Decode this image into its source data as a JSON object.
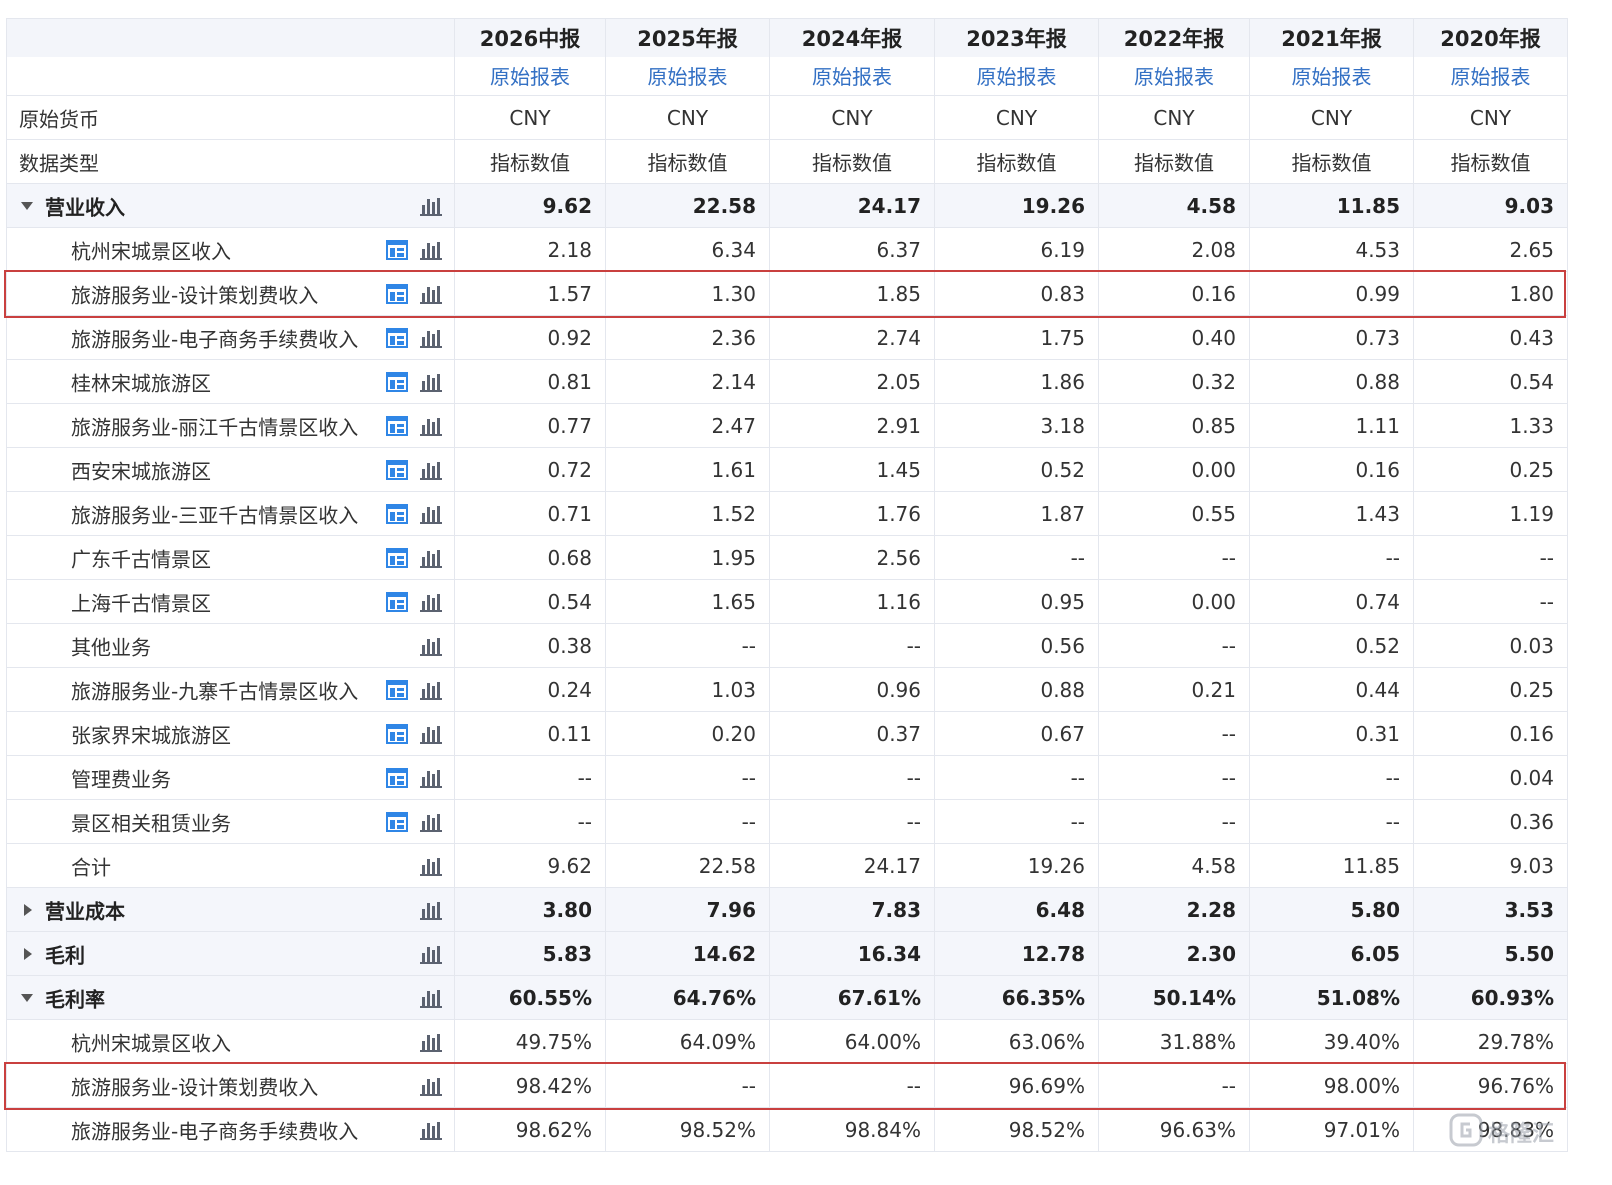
{
  "columns": [
    {
      "year": "2026中报",
      "link": "原始报表"
    },
    {
      "year": "2025年报",
      "link": "原始报表"
    },
    {
      "year": "2024年报",
      "link": "原始报表"
    },
    {
      "year": "2023年报",
      "link": "原始报表"
    },
    {
      "year": "2022年报",
      "link": "原始报表"
    },
    {
      "year": "2021年报",
      "link": "原始报表"
    },
    {
      "year": "2020年报",
      "link": "原始报表"
    }
  ],
  "meta_rows": [
    {
      "label": "原始货币",
      "values": [
        "CNY",
        "CNY",
        "CNY",
        "CNY",
        "CNY",
        "CNY",
        "CNY"
      ]
    },
    {
      "label": "数据类型",
      "values": [
        "指标数值",
        "指标数值",
        "指标数值",
        "指标数值",
        "指标数值",
        "指标数值",
        "指标数值"
      ]
    }
  ],
  "rows": [
    {
      "label": "营业收入",
      "bold": true,
      "caret": "down",
      "level": 0,
      "table_icon": false,
      "values": [
        "9.62",
        "22.58",
        "24.17",
        "19.26",
        "4.58",
        "11.85",
        "9.03"
      ]
    },
    {
      "label": "杭州宋城景区收入",
      "level": 1,
      "table_icon": true,
      "values": [
        "2.18",
        "6.34",
        "6.37",
        "6.19",
        "2.08",
        "4.53",
        "2.65"
      ]
    },
    {
      "label": "旅游服务业-设计策划费收入",
      "level": 1,
      "table_icon": true,
      "highlight": true,
      "values": [
        "1.57",
        "1.30",
        "1.85",
        "0.83",
        "0.16",
        "0.99",
        "1.80"
      ]
    },
    {
      "label": "旅游服务业-电子商务手续费收入",
      "level": 1,
      "table_icon": true,
      "values": [
        "0.92",
        "2.36",
        "2.74",
        "1.75",
        "0.40",
        "0.73",
        "0.43"
      ]
    },
    {
      "label": "桂林宋城旅游区",
      "level": 1,
      "table_icon": true,
      "values": [
        "0.81",
        "2.14",
        "2.05",
        "1.86",
        "0.32",
        "0.88",
        "0.54"
      ]
    },
    {
      "label": "旅游服务业-丽江千古情景区收入",
      "level": 1,
      "table_icon": true,
      "values": [
        "0.77",
        "2.47",
        "2.91",
        "3.18",
        "0.85",
        "1.11",
        "1.33"
      ]
    },
    {
      "label": "西安宋城旅游区",
      "level": 1,
      "table_icon": true,
      "values": [
        "0.72",
        "1.61",
        "1.45",
        "0.52",
        "0.00",
        "0.16",
        "0.25"
      ]
    },
    {
      "label": "旅游服务业-三亚千古情景区收入",
      "level": 1,
      "table_icon": true,
      "values": [
        "0.71",
        "1.52",
        "1.76",
        "1.87",
        "0.55",
        "1.43",
        "1.19"
      ]
    },
    {
      "label": "广东千古情景区",
      "level": 1,
      "table_icon": true,
      "values": [
        "0.68",
        "1.95",
        "2.56",
        "--",
        "--",
        "--",
        "--"
      ]
    },
    {
      "label": "上海千古情景区",
      "level": 1,
      "table_icon": true,
      "values": [
        "0.54",
        "1.65",
        "1.16",
        "0.95",
        "0.00",
        "0.74",
        "--"
      ]
    },
    {
      "label": "其他业务",
      "level": 1,
      "table_icon": false,
      "values": [
        "0.38",
        "--",
        "--",
        "0.56",
        "--",
        "0.52",
        "0.03"
      ]
    },
    {
      "label": "旅游服务业-九寨千古情景区收入",
      "level": 1,
      "table_icon": true,
      "values": [
        "0.24",
        "1.03",
        "0.96",
        "0.88",
        "0.21",
        "0.44",
        "0.25"
      ]
    },
    {
      "label": "张家界宋城旅游区",
      "level": 1,
      "table_icon": true,
      "values": [
        "0.11",
        "0.20",
        "0.37",
        "0.67",
        "--",
        "0.31",
        "0.16"
      ]
    },
    {
      "label": "管理费业务",
      "level": 1,
      "table_icon": true,
      "values": [
        "--",
        "--",
        "--",
        "--",
        "--",
        "--",
        "0.04"
      ]
    },
    {
      "label": "景区相关租赁业务",
      "level": 1,
      "table_icon": true,
      "values": [
        "--",
        "--",
        "--",
        "--",
        "--",
        "--",
        "0.36"
      ]
    },
    {
      "label": "合计",
      "level": 1,
      "table_icon": false,
      "values": [
        "9.62",
        "22.58",
        "24.17",
        "19.26",
        "4.58",
        "11.85",
        "9.03"
      ]
    },
    {
      "label": "营业成本",
      "bold": true,
      "caret": "right",
      "level": 0,
      "table_icon": false,
      "values": [
        "3.80",
        "7.96",
        "7.83",
        "6.48",
        "2.28",
        "5.80",
        "3.53"
      ]
    },
    {
      "label": "毛利",
      "bold": true,
      "caret": "right",
      "level": 0,
      "table_icon": false,
      "values": [
        "5.83",
        "14.62",
        "16.34",
        "12.78",
        "2.30",
        "6.05",
        "5.50"
      ]
    },
    {
      "label": "毛利率",
      "bold": true,
      "caret": "down",
      "level": 0,
      "table_icon": false,
      "values": [
        "60.55%",
        "64.76%",
        "67.61%",
        "66.35%",
        "50.14%",
        "51.08%",
        "60.93%"
      ]
    },
    {
      "label": "杭州宋城景区收入",
      "level": 1,
      "table_icon": false,
      "values": [
        "49.75%",
        "64.09%",
        "64.00%",
        "63.06%",
        "31.88%",
        "39.40%",
        "29.78%"
      ]
    },
    {
      "label": "旅游服务业-设计策划费收入",
      "level": 1,
      "table_icon": false,
      "highlight": true,
      "values": [
        "98.42%",
        "--",
        "--",
        "96.69%",
        "--",
        "98.00%",
        "96.76%"
      ]
    },
    {
      "label": "旅游服务业-电子商务手续费收入",
      "level": 1,
      "table_icon": false,
      "values": [
        "98.62%",
        "98.52%",
        "98.84%",
        "98.52%",
        "96.63%",
        "97.01%",
        "98.83%"
      ]
    }
  ],
  "watermark": {
    "text": "格隆汇",
    "icon": "glh-logo-icon"
  },
  "icons": {
    "bar": "bar-chart-icon",
    "table": "table-chart-icon"
  },
  "colors": {
    "link": "#3370c4",
    "highlight": "#c9403f",
    "icon_blue": "#2f86e6",
    "icon_gray": "#5b6270"
  }
}
